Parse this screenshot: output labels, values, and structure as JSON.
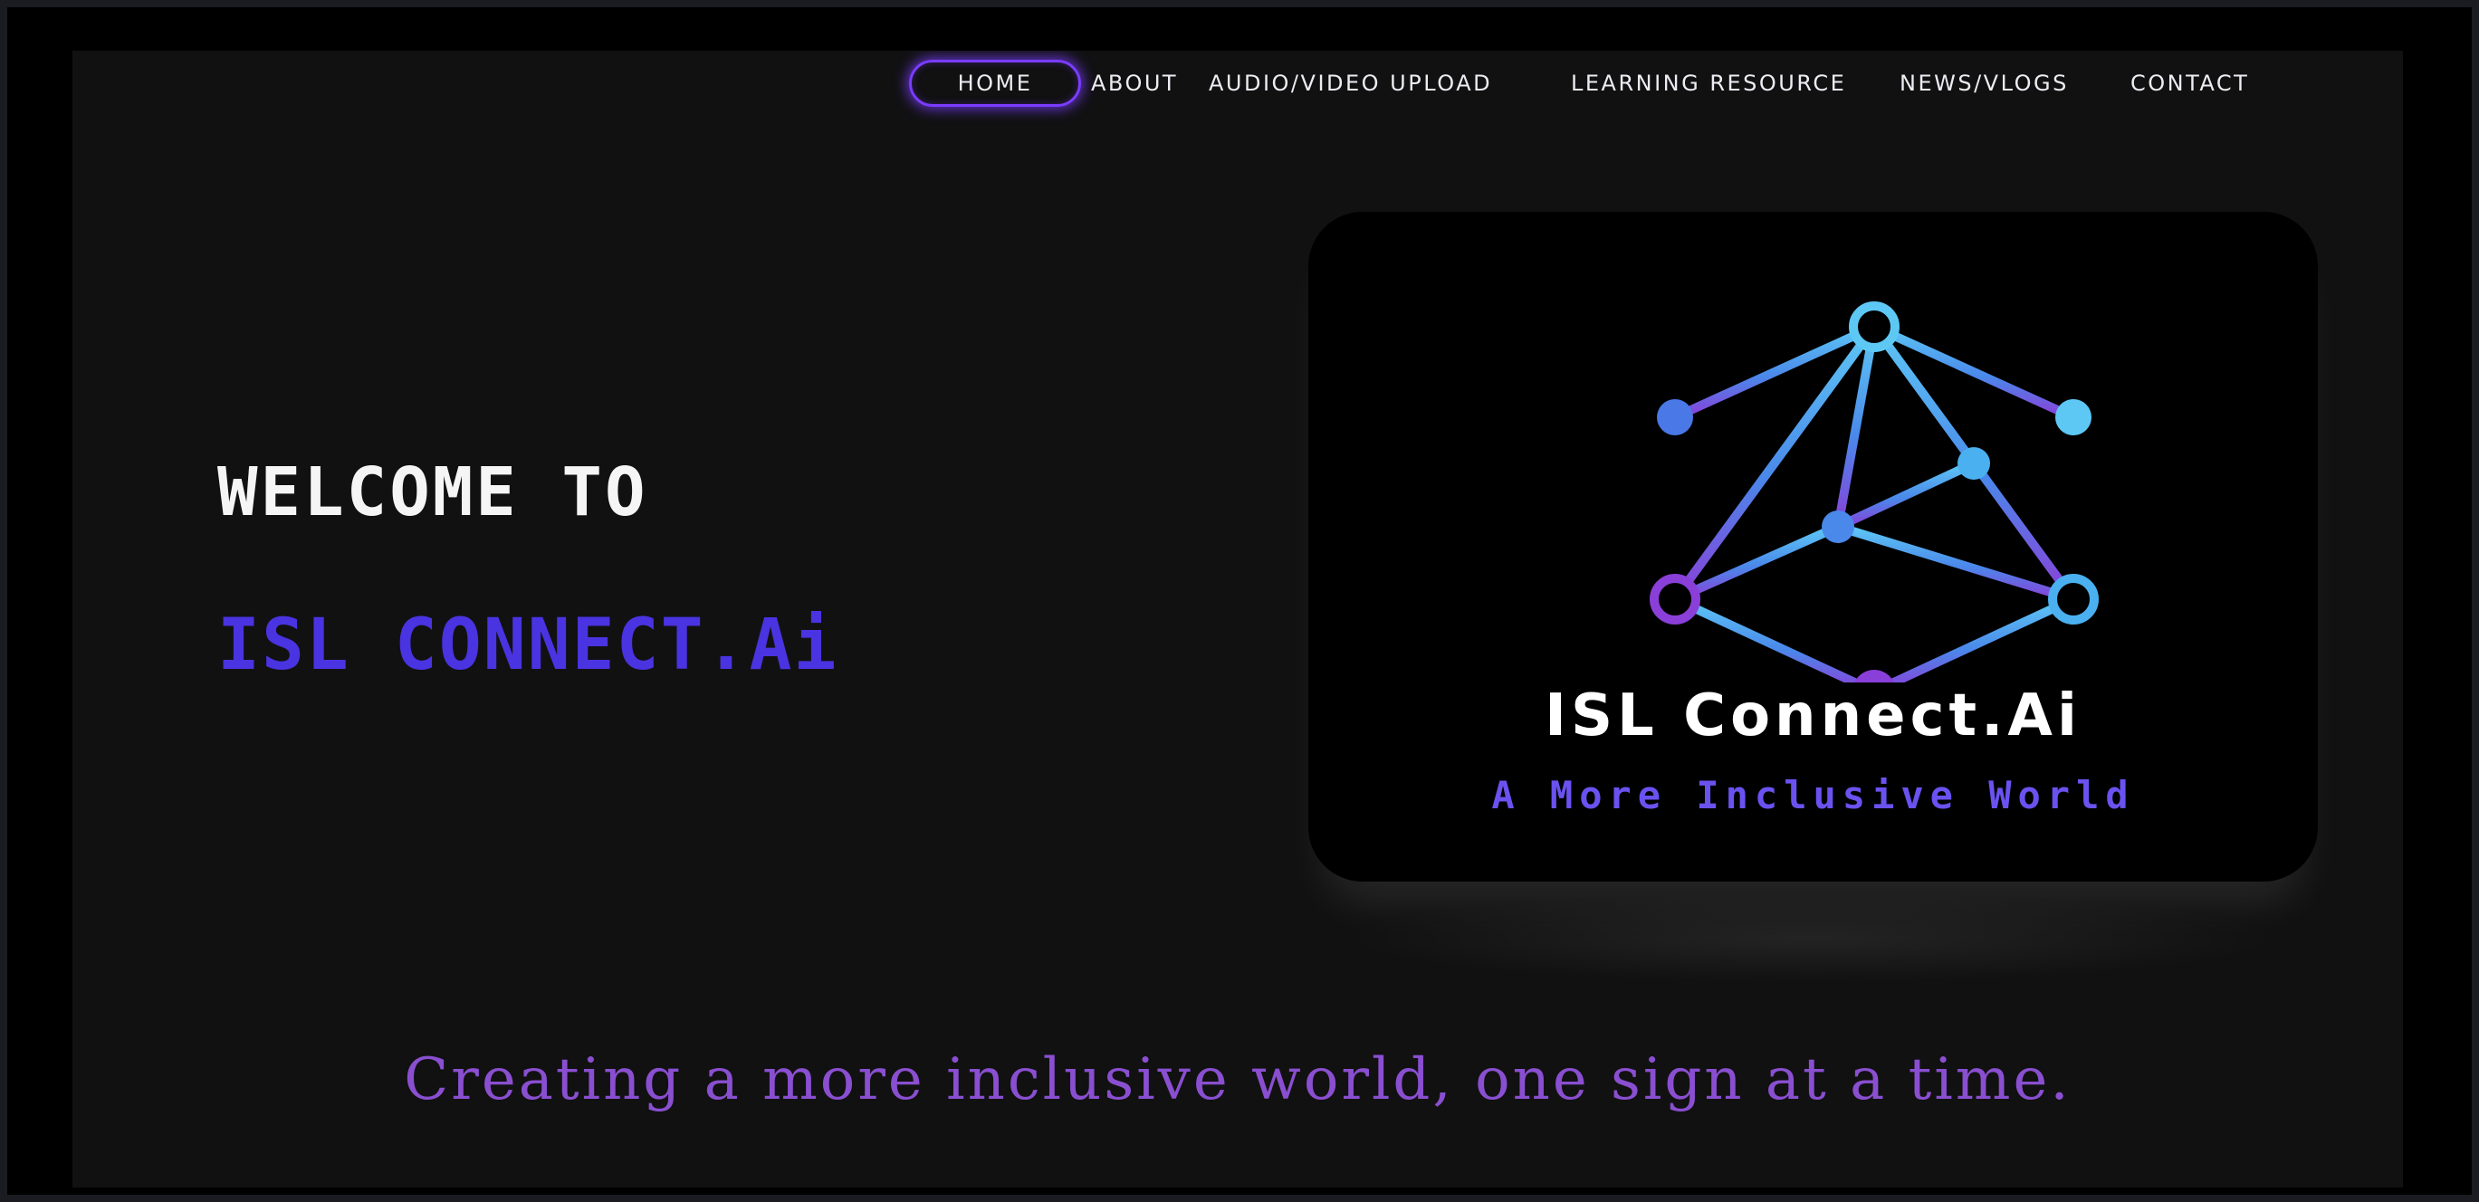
{
  "nav": {
    "items": [
      {
        "label": "HOME",
        "active": true
      },
      {
        "label": "ABOUT",
        "active": false
      },
      {
        "label": "AUDIO/VIDEO UPLOAD",
        "active": false
      },
      {
        "label": "LEARNING RESOURCE",
        "active": false
      },
      {
        "label": "NEWS/VLOGS",
        "active": false
      },
      {
        "label": "CONTACT",
        "active": false
      }
    ]
  },
  "hero": {
    "welcome": "WELCOME TO",
    "brand": "ISL CONNECT.Ai"
  },
  "logo": {
    "icon": "network-hexagon-icon",
    "name": "ISL Connect.Ai",
    "tagline": "A More Inclusive World"
  },
  "slogan": "Creating a more inclusive world, one sign at a time.",
  "colors": {
    "background": "#111112",
    "accent_purple": "#7a3cff",
    "brand_blue": "#4a33e0",
    "slogan_purple": "#8a4fd0",
    "logo_gradient_top": "#5ec8f5",
    "logo_gradient_bottom": "#8a3fd9"
  }
}
